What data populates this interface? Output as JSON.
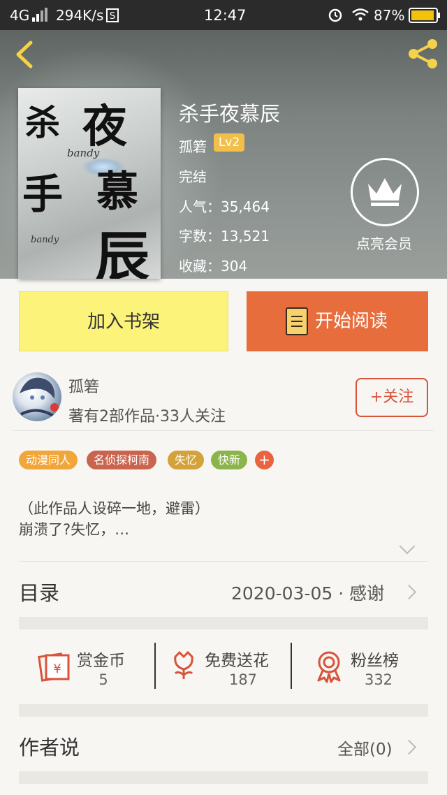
{
  "status_bar": {
    "network": "4G",
    "speed": "294K/s",
    "time": "12:47",
    "battery": "87%"
  },
  "book": {
    "cover_title_chars": [
      "杀",
      "夜",
      "手",
      "慕",
      "辰"
    ],
    "cover_signature": "bandy",
    "title": "杀手夜慕辰",
    "author": "孤箬",
    "level": "Lv2",
    "status": "完结",
    "popularity_label": "人气：",
    "popularity": "35,464",
    "words_label": "字数：",
    "words": "13,521",
    "favorites_label": "收藏：",
    "favorites": "304",
    "vip_label": "点亮会员"
  },
  "actions": {
    "add_shelf": "加入书架",
    "start_reading": "开始阅读"
  },
  "author_card": {
    "name": "孤箬",
    "meta": "著有2部作品·33人关注",
    "follow": "+关注"
  },
  "tags": [
    {
      "label": "动漫同人",
      "color": "#f0a63a"
    },
    {
      "label": "名侦探柯南",
      "color": "#c9644e"
    },
    {
      "label": "失忆",
      "color": "#d3a23a"
    },
    {
      "label": "快新",
      "color": "#8bb54a"
    }
  ],
  "tag_more": "+",
  "description": {
    "line1": "（此作品人设碎一地，避雷）",
    "line2": "崩溃了?失忆，…"
  },
  "catalog": {
    "title": "目录",
    "date": "2020-03-05 · 感谢"
  },
  "stats": [
    {
      "label": "赏金币",
      "value": "5",
      "icon": "coin-envelope-icon"
    },
    {
      "label": "免费送花",
      "value": "187",
      "icon": "flower-icon"
    },
    {
      "label": "粉丝榜",
      "value": "332",
      "icon": "medal-icon"
    }
  ],
  "author_says": {
    "title": "作者说",
    "all": "全部(0)"
  },
  "colors": {
    "accent_orange": "#e76d3d",
    "shelf_yellow": "#fbf37a",
    "red_icon": "#d9533b",
    "level_badge": "#f2c04a"
  }
}
